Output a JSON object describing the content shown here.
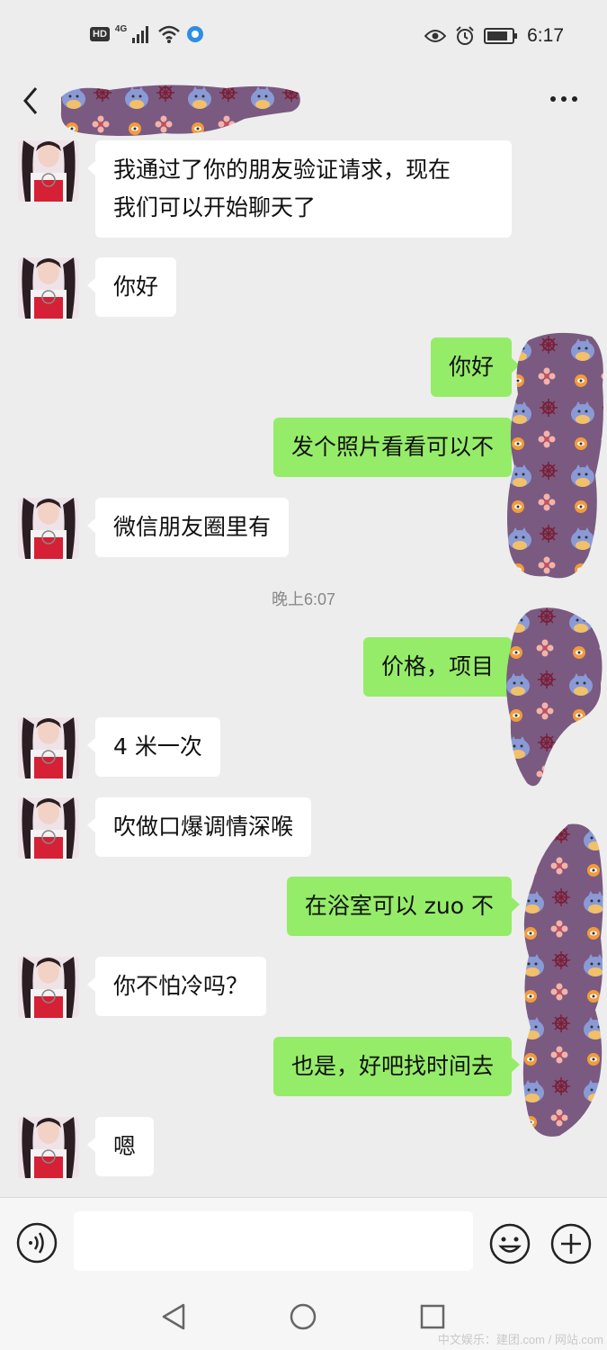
{
  "status_bar": {
    "hd_label": "HD",
    "network_label": "4G",
    "time": "6:17"
  },
  "header": {
    "contact_name": ""
  },
  "messages": [
    {
      "side": "in",
      "text_line1": "我通过了你的朋友验证请求，现在",
      "text_line2": "我们可以开始聊天了"
    },
    {
      "side": "in",
      "text": "你好"
    },
    {
      "side": "out",
      "text": "你好"
    },
    {
      "side": "out",
      "text": "发个照片看看可以不"
    },
    {
      "side": "in",
      "text": "微信朋友圈里有"
    },
    {
      "side": "out",
      "text": "价格，项目"
    },
    {
      "side": "in",
      "text": "4 米一次"
    },
    {
      "side": "in",
      "text": "吹做口爆调情深喉"
    },
    {
      "side": "out",
      "text": "在浴室可以 zuo 不"
    },
    {
      "side": "in",
      "text": "你不怕冷吗？"
    },
    {
      "side": "out",
      "text": "也是，好吧找时间去"
    },
    {
      "side": "in",
      "text": "嗯"
    }
  ],
  "time_divider": "晚上6:07",
  "input_bar": {
    "placeholder": ""
  },
  "watermark": "中文娱乐：建团.com / 网站.com",
  "colors": {
    "background": "#ededed",
    "incoming_bubble": "#ffffff",
    "outgoing_bubble": "#95ec69",
    "mask_purple": "#7a5a80"
  },
  "icons": [
    "back-arrow-icon",
    "more-dots-icon",
    "voice-icon",
    "emoji-icon",
    "plus-icon",
    "eye-icon",
    "alarm-icon",
    "battery-icon",
    "wifi-icon",
    "signal-icon"
  ]
}
